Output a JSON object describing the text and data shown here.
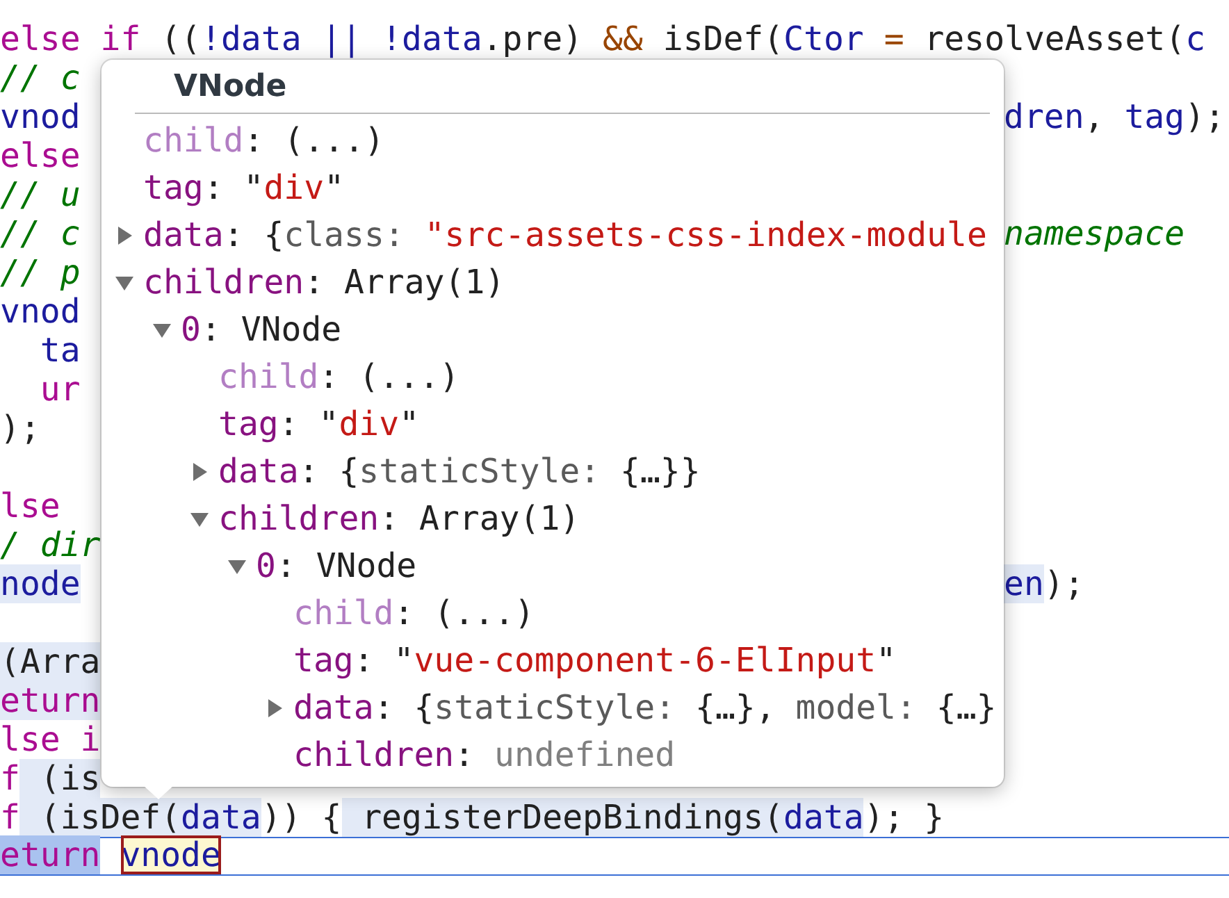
{
  "code_lines": [
    {
      "kind": "code",
      "tokens": [
        {
          "kind": "keyword",
          "text": "else if",
          "highlighted": false
        },
        {
          "kind": "plain",
          "text": " ((",
          "highlighted": false
        },
        {
          "kind": "variable",
          "text": "!data || !data",
          "highlighted": false
        },
        {
          "kind": "plain",
          "text": ".pre)",
          "highlighted": false
        },
        {
          "kind": "operator",
          "text": " &&",
          "highlighted": false
        },
        {
          "kind": "plain",
          "text": " isDef(",
          "highlighted": false
        },
        {
          "kind": "variable",
          "text": "Ctor",
          "highlighted": false
        },
        {
          "kind": "operator",
          "text": " =",
          "highlighted": false
        },
        {
          "kind": "plain",
          "text": " resolveAsset(",
          "highlighted": false
        },
        {
          "kind": "variable",
          "text": "c",
          "highlighted": false
        }
      ]
    },
    {
      "kind": "code",
      "tokens": [
        {
          "kind": "comment",
          "text": "// c",
          "highlighted": false
        }
      ]
    },
    {
      "kind": "code",
      "tokens": [
        {
          "kind": "variable",
          "text": "vnod",
          "highlighted": false
        }
      ],
      "tail": [
        {
          "kind": "variable",
          "text": "dren",
          "highlighted": false
        },
        {
          "kind": "plain",
          "text": ", ",
          "highlighted": false
        },
        {
          "kind": "variable",
          "text": "tag",
          "highlighted": false
        },
        {
          "kind": "plain",
          "text": ");",
          "highlighted": false
        }
      ]
    },
    {
      "kind": "code",
      "tokens": [
        {
          "kind": "keyword",
          "text": "else",
          "highlighted": false
        }
      ]
    },
    {
      "kind": "code",
      "tokens": [
        {
          "kind": "comment",
          "text": "// u",
          "highlighted": false
        }
      ]
    },
    {
      "kind": "code",
      "tokens": [
        {
          "kind": "comment",
          "text": "// c",
          "highlighted": false
        }
      ],
      "tail": [
        {
          "kind": "comment",
          "text": "namespace",
          "highlighted": false
        }
      ]
    },
    {
      "kind": "code",
      "tokens": [
        {
          "kind": "comment",
          "text": "// p",
          "highlighted": false
        }
      ]
    },
    {
      "kind": "code",
      "tokens": [
        {
          "kind": "variable",
          "text": "vnod",
          "highlighted": false
        }
      ]
    },
    {
      "kind": "code",
      "tokens": [
        {
          "kind": "variable",
          "text": "  ta",
          "highlighted": false
        }
      ]
    },
    {
      "kind": "code",
      "tokens": [
        {
          "kind": "keyword",
          "text": "  ur",
          "highlighted": false
        }
      ]
    },
    {
      "kind": "code",
      "tokens": [
        {
          "kind": "plain",
          "text": ");",
          "highlighted": false
        }
      ]
    },
    {
      "kind": "blank"
    },
    {
      "kind": "code",
      "tokens": [
        {
          "kind": "keyword",
          "text": "lse",
          "highlighted": false
        }
      ]
    },
    {
      "kind": "code",
      "tokens": [
        {
          "kind": "comment",
          "text": "/ dir",
          "highlighted": false
        }
      ]
    },
    {
      "kind": "code",
      "tokens": [
        {
          "kind": "variable",
          "text": "node",
          "highlighted": true
        }
      ],
      "tail": [
        {
          "kind": "variable",
          "text": "en",
          "highlighted": true
        },
        {
          "kind": "plain",
          "text": ");",
          "highlighted": false
        }
      ]
    },
    {
      "kind": "blank"
    },
    {
      "kind": "code",
      "tokens": [
        {
          "kind": "plain",
          "text": "(Arra",
          "highlighted": true
        }
      ]
    },
    {
      "kind": "code",
      "tokens": [
        {
          "kind": "keyword",
          "text": "eturn",
          "highlighted": true
        }
      ]
    },
    {
      "kind": "code",
      "tokens": [
        {
          "kind": "keyword",
          "text": "lse i",
          "highlighted": false
        }
      ]
    },
    {
      "kind": "code",
      "tokens": [
        {
          "kind": "keyword",
          "text": "f",
          "highlighted": false
        },
        {
          "kind": "plain",
          "text": " (is",
          "highlighted": true
        }
      ]
    },
    {
      "kind": "code",
      "tokens": [
        {
          "kind": "keyword",
          "text": "f",
          "highlighted": false
        },
        {
          "kind": "plain",
          "text": " (isDef(",
          "highlighted": true
        },
        {
          "kind": "variable",
          "text": "data",
          "highlighted": true
        },
        {
          "kind": "plain",
          "text": ")) {",
          "highlighted": false
        },
        {
          "kind": "plain",
          "text": " registerDeepBindings(",
          "highlighted": true
        },
        {
          "kind": "variable",
          "text": "data",
          "highlighted": true
        },
        {
          "kind": "plain",
          "text": "); }",
          "highlighted": false
        }
      ]
    },
    {
      "kind": "current",
      "tokens": [
        {
          "kind": "keyword",
          "text": "eturn",
          "highlighted": true
        },
        {
          "kind": "variable",
          "text": "vnode",
          "highlighted": true,
          "boxed": true
        }
      ]
    }
  ],
  "popover": {
    "title": "VNode",
    "properties": [
      {
        "kind": "leaf",
        "name": "child",
        "lazy": true,
        "value": [
          {
            "kind": "text",
            "text": ": (...)"
          }
        ]
      },
      {
        "kind": "leaf",
        "name": "tag",
        "lazy": false,
        "value": [
          {
            "kind": "text",
            "text": ": \""
          },
          {
            "kind": "string",
            "text": "div"
          },
          {
            "kind": "text",
            "text": "\""
          }
        ]
      },
      {
        "kind": "branch",
        "expanded": false,
        "name": "data",
        "lazy": false,
        "value": [
          {
            "kind": "text",
            "text": ": {"
          },
          {
            "kind": "key",
            "text": "class: "
          },
          {
            "kind": "string",
            "text": "\"src-assets-css-index-module"
          }
        ]
      },
      {
        "kind": "branch",
        "expanded": true,
        "name": "children",
        "lazy": false,
        "value": [
          {
            "kind": "text",
            "text": ": Array(1)"
          }
        ],
        "children": [
          {
            "kind": "branch",
            "expanded": true,
            "name": "0",
            "lazy": false,
            "value": [
              {
                "kind": "text",
                "text": ": VNode"
              }
            ],
            "children": [
              {
                "kind": "leaf",
                "name": "child",
                "lazy": true,
                "value": [
                  {
                    "kind": "text",
                    "text": ": (...)"
                  }
                ]
              },
              {
                "kind": "leaf",
                "name": "tag",
                "lazy": false,
                "value": [
                  {
                    "kind": "text",
                    "text": ": \""
                  },
                  {
                    "kind": "string",
                    "text": "div"
                  },
                  {
                    "kind": "text",
                    "text": "\""
                  }
                ]
              },
              {
                "kind": "branch",
                "expanded": false,
                "name": "data",
                "lazy": false,
                "value": [
                  {
                    "kind": "text",
                    "text": ": {"
                  },
                  {
                    "kind": "key",
                    "text": "staticStyle: "
                  },
                  {
                    "kind": "text",
                    "text": "{…}}"
                  }
                ]
              },
              {
                "kind": "branch",
                "expanded": true,
                "name": "children",
                "lazy": false,
                "value": [
                  {
                    "kind": "text",
                    "text": ": Array(1)"
                  }
                ],
                "children": [
                  {
                    "kind": "branch",
                    "expanded": true,
                    "name": "0",
                    "lazy": false,
                    "value": [
                      {
                        "kind": "text",
                        "text": ": VNode"
                      }
                    ],
                    "children": [
                      {
                        "kind": "leaf",
                        "name": "child",
                        "lazy": true,
                        "value": [
                          {
                            "kind": "text",
                            "text": ": (...)"
                          }
                        ]
                      },
                      {
                        "kind": "leaf",
                        "name": "tag",
                        "lazy": false,
                        "value": [
                          {
                            "kind": "text",
                            "text": ": \""
                          },
                          {
                            "kind": "string",
                            "text": "vue-component-6-ElInput"
                          },
                          {
                            "kind": "text",
                            "text": "\""
                          }
                        ]
                      },
                      {
                        "kind": "branch",
                        "expanded": false,
                        "name": "data",
                        "lazy": false,
                        "value": [
                          {
                            "kind": "text",
                            "text": ": {"
                          },
                          {
                            "kind": "key",
                            "text": "staticStyle: "
                          },
                          {
                            "kind": "text",
                            "text": "{…}, "
                          },
                          {
                            "kind": "key",
                            "text": "model: "
                          },
                          {
                            "kind": "text",
                            "text": "{…}"
                          }
                        ]
                      },
                      {
                        "kind": "leaf",
                        "name": "children",
                        "lazy": false,
                        "value": [
                          {
                            "kind": "text",
                            "text": ": "
                          },
                          {
                            "kind": "undefined",
                            "text": "undefined"
                          }
                        ]
                      }
                    ]
                  }
                ]
              }
            ]
          }
        ]
      }
    ]
  }
}
